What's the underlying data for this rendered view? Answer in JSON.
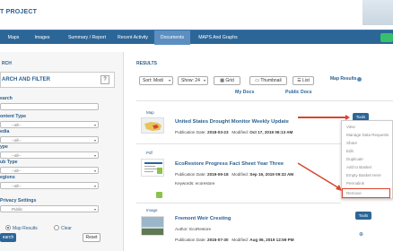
{
  "header": {
    "project_title": "T PROJECT"
  },
  "nav": {
    "tabs": [
      {
        "label": "Maps"
      },
      {
        "label": "Images"
      },
      {
        "label": "Summary / Report"
      },
      {
        "label": "Recent Activity"
      },
      {
        "label": "Documents"
      },
      {
        "label": "MAPS And Graphs"
      }
    ],
    "active": "Documents"
  },
  "left": {
    "section_heading": "RCH",
    "filter_title": "ARCH AND FILTER",
    "help": "?",
    "search_label": "earch",
    "content_type_label": "ontent Type",
    "media_label": "edia",
    "type_label": "ype",
    "sub_type_label": "ub Type",
    "regions_label": "egions",
    "privacy_label": "Privacy Settings",
    "select_placeholder": "--all--",
    "privacy_value": "Public",
    "map_results_label": "Map Results",
    "clear_label": "Clear",
    "search_button": "earch",
    "reset_button": "Reset"
  },
  "results": {
    "heading": "RESULTS",
    "sort_value": "Sort: Modi",
    "show_value": "Show: 24",
    "grid_label": "Grid",
    "thumbnail_label": "Thumbnail",
    "list_label": "List",
    "map_results_link": "Map Results",
    "tabs": [
      "My Docs",
      "Public Docs"
    ],
    "items": [
      {
        "type": "Map",
        "title": "United States Drought Monitor Weekly Update",
        "line1_label": "Publication Date:",
        "line1_value": "2018-03-23",
        "line2_label": "Modified:",
        "line2_value": "Oct 17, 2019 06:13 AM",
        "tools": "Tools"
      },
      {
        "type": "Pdf",
        "title": "EcoRestore Progress Fact Sheet Year Three",
        "line1_label": "Publication Date:",
        "line1_value": "2019-09-18",
        "line2_label": "Modified:",
        "line2_value": "Sep 19, 2019 09:32 AM",
        "keywords_label": "Keywords:",
        "keywords_value": "ecorestore"
      },
      {
        "type": "Image",
        "title": "Fremont Weir Cresting",
        "author_label": "Author:",
        "author_value": "EcoRestore",
        "line1_label": "Publication Date:",
        "line1_value": "2015-07-30",
        "line2_label": "Modified:",
        "line2_value": "Aug 06, 2019 12:59 PM",
        "tools": "Tools"
      }
    ]
  },
  "tools_menu": {
    "items": [
      "View",
      "Manage Data Requests",
      "Share",
      "Edit",
      "Duplicate",
      "Add to Basket",
      "Empty Basket Here",
      "Permalink",
      "Remove"
    ],
    "highlighted": "Remove"
  },
  "colors": {
    "brand_blue": "#2c6697",
    "accent_red": "#d9452e",
    "active_tab": "#5c8fc0"
  }
}
